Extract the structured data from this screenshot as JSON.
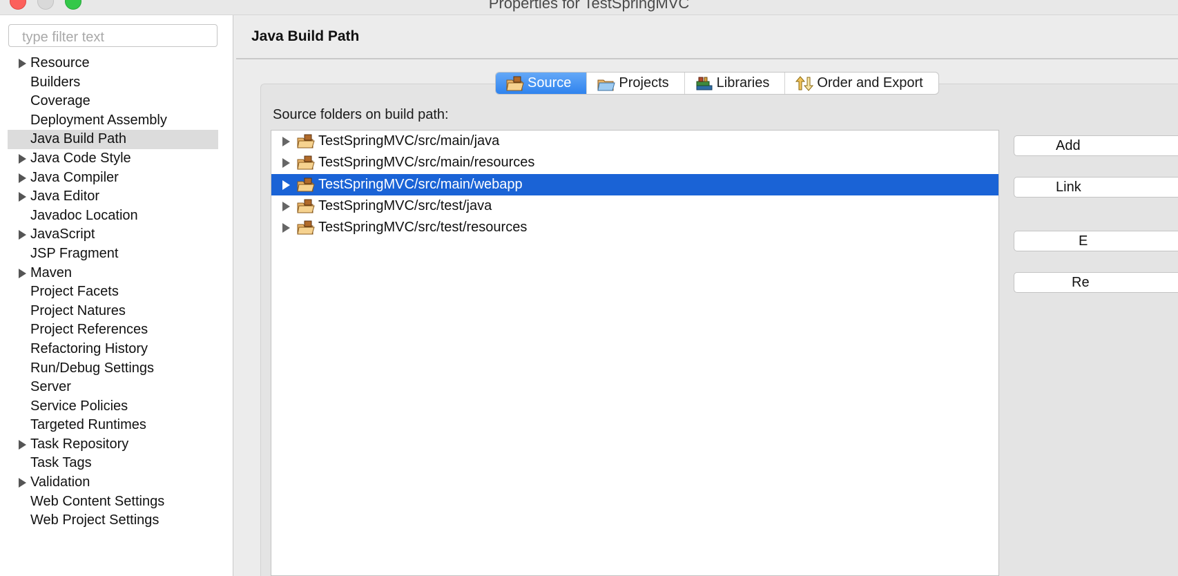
{
  "window": {
    "title": "Properties for TestSpringMVC"
  },
  "sidebar": {
    "filter_placeholder": "type filter text",
    "items": [
      {
        "label": "Resource",
        "expandable": true
      },
      {
        "label": "Builders",
        "expandable": false
      },
      {
        "label": "Coverage",
        "expandable": false
      },
      {
        "label": "Deployment Assembly",
        "expandable": false
      },
      {
        "label": "Java Build Path",
        "expandable": false,
        "selected": true
      },
      {
        "label": "Java Code Style",
        "expandable": true
      },
      {
        "label": "Java Compiler",
        "expandable": true
      },
      {
        "label": "Java Editor",
        "expandable": true
      },
      {
        "label": "Javadoc Location",
        "expandable": false
      },
      {
        "label": "JavaScript",
        "expandable": true
      },
      {
        "label": "JSP Fragment",
        "expandable": false
      },
      {
        "label": "Maven",
        "expandable": true
      },
      {
        "label": "Project Facets",
        "expandable": false
      },
      {
        "label": "Project Natures",
        "expandable": false
      },
      {
        "label": "Project References",
        "expandable": false
      },
      {
        "label": "Refactoring History",
        "expandable": false
      },
      {
        "label": "Run/Debug Settings",
        "expandable": false
      },
      {
        "label": "Server",
        "expandable": false
      },
      {
        "label": "Service Policies",
        "expandable": false
      },
      {
        "label": "Targeted Runtimes",
        "expandable": false
      },
      {
        "label": "Task Repository",
        "expandable": true
      },
      {
        "label": "Task Tags",
        "expandable": false
      },
      {
        "label": "Validation",
        "expandable": true
      },
      {
        "label": "Web Content Settings",
        "expandable": false
      },
      {
        "label": "Web Project Settings",
        "expandable": false
      }
    ]
  },
  "main": {
    "title": "Java Build Path",
    "tabs": [
      {
        "label": "Source",
        "icon": "source-folder-icon",
        "active": true
      },
      {
        "label": "Projects",
        "icon": "projects-folder-icon",
        "active": false
      },
      {
        "label": "Libraries",
        "icon": "libraries-icon",
        "active": false
      },
      {
        "label": "Order and Export",
        "icon": "order-export-icon",
        "active": false
      }
    ],
    "section_label": "Source folders on build path:",
    "source_folders": [
      {
        "path": "TestSpringMVC/src/main/java",
        "selected": false
      },
      {
        "path": "TestSpringMVC/src/main/resources",
        "selected": false
      },
      {
        "path": "TestSpringMVC/src/main/webapp",
        "selected": true
      },
      {
        "path": "TestSpringMVC/src/test/java",
        "selected": false
      },
      {
        "path": "TestSpringMVC/src/test/resources",
        "selected": false
      }
    ],
    "buttons": [
      {
        "label": "Add",
        "name": "add-folder-button"
      },
      {
        "label": "Link",
        "name": "link-source-button"
      },
      {
        "label": "E",
        "name": "edit-button"
      },
      {
        "label": "Re",
        "name": "remove-button"
      }
    ]
  },
  "colors": {
    "selection_blue": "#1a63d6",
    "tab_active": "#2f83ee",
    "sidebar_selected": "#dcdcdc",
    "folder_tan": "#e8b46a"
  }
}
